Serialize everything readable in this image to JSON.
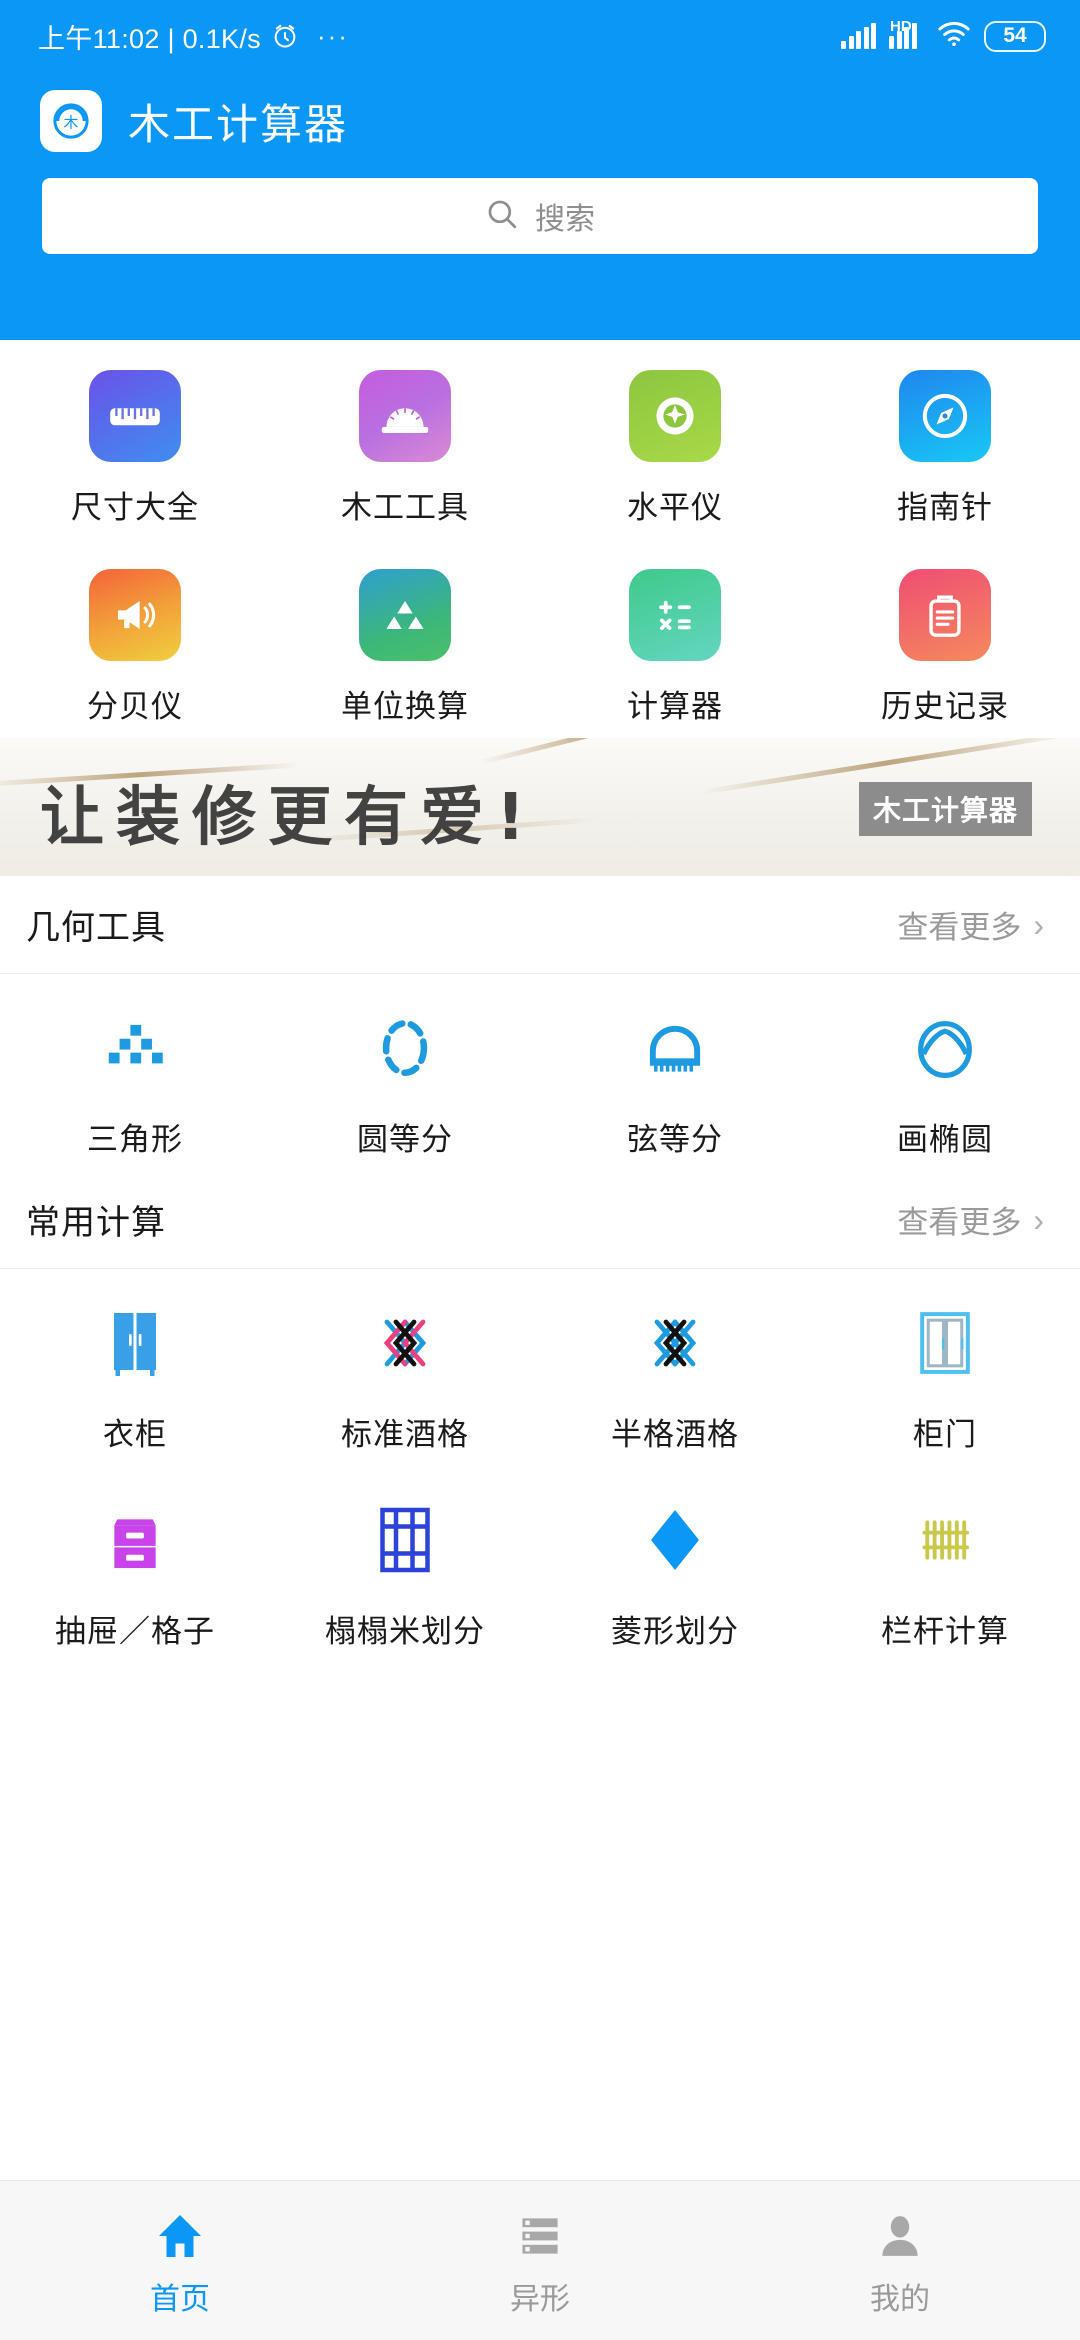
{
  "status_bar": {
    "time_text": "上午11:02 | 0.1K/s",
    "alarm_icon": "alarm-icon",
    "more_dots": "···",
    "signal_icon": "signal-bars-icon",
    "hd_label": "HD",
    "wifi_icon": "wifi-icon",
    "battery_level": "54"
  },
  "header": {
    "app_title": "木工计算器",
    "logo_char": "木",
    "accent_color": "#0a97f5"
  },
  "search": {
    "placeholder": "搜索",
    "value": "",
    "icon": "search-icon"
  },
  "quick_tools": [
    {
      "label": "尺寸大全",
      "icon": "ruler-icon"
    },
    {
      "label": "木工工具",
      "icon": "protractor-icon"
    },
    {
      "label": "水平仪",
      "icon": "level-icon"
    },
    {
      "label": "指南针",
      "icon": "compass-icon"
    },
    {
      "label": "分贝仪",
      "icon": "megaphone-icon"
    },
    {
      "label": "单位换算",
      "icon": "triangles-icon"
    },
    {
      "label": "计算器",
      "icon": "calculator-icon"
    },
    {
      "label": "历史记录",
      "icon": "clipboard-icon"
    }
  ],
  "banner": {
    "slogan": "让装修更有爱!",
    "badge": "木工计算器"
  },
  "sections": [
    {
      "title": "几何工具",
      "more_label": "查看更多",
      "more_chevron": "›",
      "items": [
        {
          "label": "三角形",
          "icon": "triangle-blocks-icon"
        },
        {
          "label": "圆等分",
          "icon": "dashed-circle-icon"
        },
        {
          "label": "弦等分",
          "icon": "arc-comb-icon"
        },
        {
          "label": "画椭圆",
          "icon": "ellipse-icon"
        }
      ]
    },
    {
      "title": "常用计算",
      "more_label": "查看更多",
      "more_chevron": "›",
      "items": [
        {
          "label": "衣柜",
          "icon": "wardrobe-icon"
        },
        {
          "label": "标准酒格",
          "icon": "wine-lattice-icon"
        },
        {
          "label": "半格酒格",
          "icon": "half-lattice-icon"
        },
        {
          "label": "柜门",
          "icon": "cabinet-door-icon"
        },
        {
          "label": "抽屉／格子",
          "icon": "drawer-icon"
        },
        {
          "label": "榻榻米划分",
          "icon": "tatami-icon"
        },
        {
          "label": "菱形划分",
          "icon": "diamond-icon"
        },
        {
          "label": "栏杆计算",
          "icon": "railing-icon"
        }
      ]
    }
  ],
  "bottom_nav": [
    {
      "label": "首页",
      "icon": "home-icon",
      "active": true
    },
    {
      "label": "异形",
      "icon": "list-icon",
      "active": false
    },
    {
      "label": "我的",
      "icon": "person-icon",
      "active": false
    }
  ]
}
